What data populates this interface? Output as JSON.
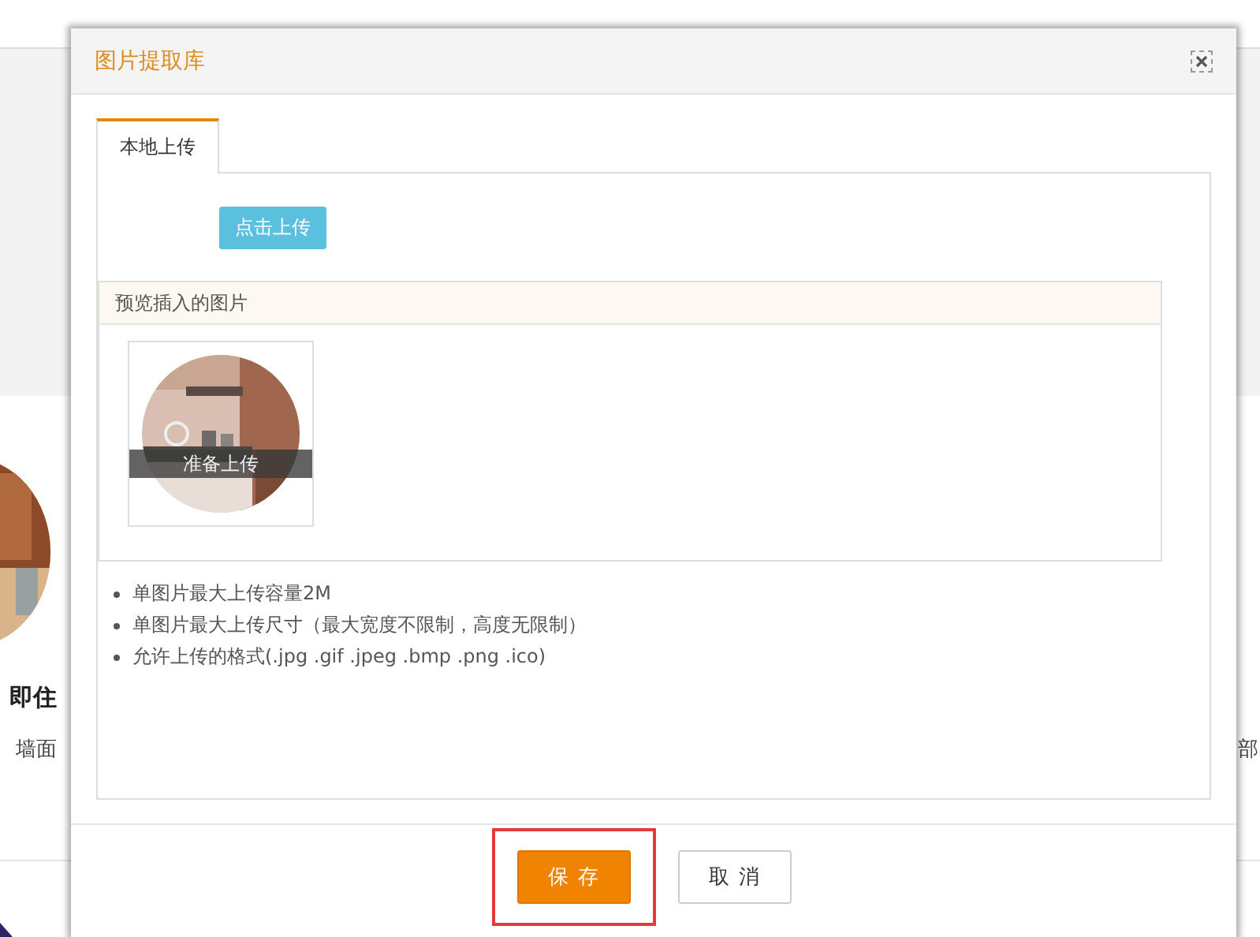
{
  "background_page": {
    "left_texts": [
      {
        "text": "即住",
        "kind": "heading"
      },
      {
        "text": "墙面",
        "kind": "body"
      }
    ],
    "right_texts": [
      {
        "text": "部"
      }
    ]
  },
  "dialog": {
    "title": "图片提取库",
    "tabs": [
      {
        "label": "本地上传",
        "selected": true
      }
    ],
    "upload_button": "点击上传",
    "preview": {
      "heading": "预览插入的图片",
      "items": [
        {
          "kind": "picture",
          "status": "准备上传"
        }
      ]
    },
    "notes": [
      "单图片最大上传容量2M",
      "单图片最大上传尺寸（最大宽度不限制，高度无限制）",
      "允许上传的格式(.jpg .gif .jpeg .bmp .png .ico)"
    ],
    "buttons": [
      {
        "label": "保存",
        "kind": "primary",
        "highlighted": true
      },
      {
        "label": "取消",
        "kind": "secondary",
        "highlighted": false
      }
    ]
  }
}
